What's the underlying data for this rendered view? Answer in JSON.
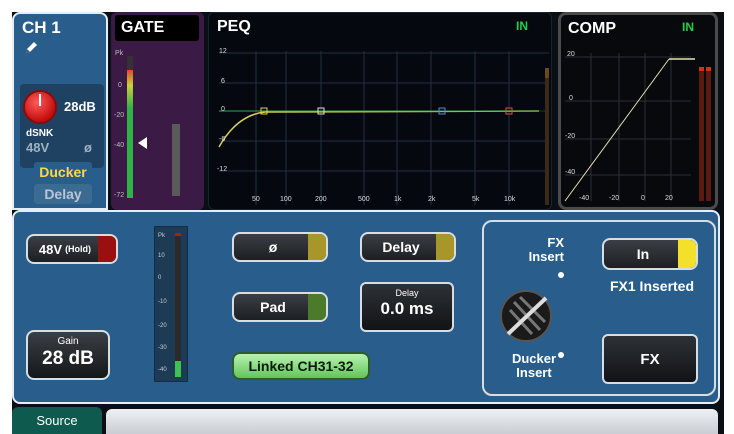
{
  "channel": {
    "title": "CH 1",
    "gain_value": "28dB",
    "source_name": "dSNK",
    "phantom_label": "48V",
    "phase_symbol": "ø",
    "ducker_label": "Ducker",
    "delay_label": "Delay"
  },
  "gate": {
    "title": "GATE",
    "scale": [
      "Pk",
      "0",
      "-20",
      "-40",
      "-72"
    ]
  },
  "peq": {
    "title": "PEQ",
    "status": "IN",
    "y_labels": [
      "12",
      "6",
      "0",
      "-6",
      "-12"
    ],
    "x_labels": [
      "50",
      "100",
      "200",
      "500",
      "1k",
      "2k",
      "5k",
      "10k"
    ]
  },
  "comp": {
    "title": "COMP",
    "status": "IN",
    "y_labels": [
      "20",
      "0",
      "-20",
      "-40"
    ],
    "x_labels": [
      "-40",
      "-20",
      "0",
      "20"
    ]
  },
  "controls": {
    "phantom_button": "48V",
    "phantom_hold": "(Hold)",
    "gain_title": "Gain",
    "gain_value": "28 dB",
    "meter_scale": [
      "Pk",
      "10",
      "0",
      "-10",
      "-20",
      "-30",
      "-40"
    ],
    "phase_button": "ø",
    "pad_button": "Pad",
    "delay_button": "Delay",
    "delay_title": "Delay",
    "delay_value": "0.0 ms",
    "linked_label": "Linked CH31-32"
  },
  "fx": {
    "fx_insert_label": "FX\nInsert",
    "ducker_insert_label": "Ducker\nInsert",
    "in_button": "In",
    "status": "FX1 Inserted",
    "fx_button": "FX"
  },
  "tabs": {
    "source": "Source"
  },
  "colors": {
    "panel_blue": "#285d8c",
    "gate_bg": "#3b1a45",
    "status_green": "#22d04a",
    "ducker_yellow": "#ffd84a",
    "linked_green": "#62c55a"
  }
}
